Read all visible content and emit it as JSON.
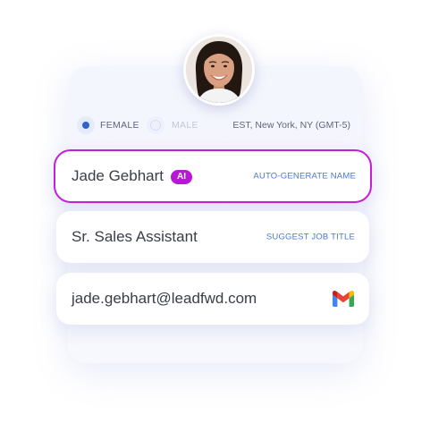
{
  "profile": {
    "avatar_icon": "profile-photo-icon"
  },
  "gender": {
    "options": [
      {
        "label": "FEMALE",
        "selected": true
      },
      {
        "label": "MALE",
        "selected": false
      }
    ]
  },
  "timezone": {
    "label": "EST, New York, NY (GMT-5)"
  },
  "name_field": {
    "value": "Jade Gebhart",
    "badge": "AI",
    "action": "AUTO-GENERATE NAME",
    "highlight_color": "#c31fd6"
  },
  "title_field": {
    "value": "Sr. Sales Assistant",
    "action": "SUGGEST JOB TITLE"
  },
  "email_field": {
    "value": "jade.gebhart@leadfwd.com",
    "icon": "gmail-icon"
  },
  "colors": {
    "accent": "#2e64c8",
    "link": "#4b78cf",
    "badge": "#b51ad2"
  }
}
